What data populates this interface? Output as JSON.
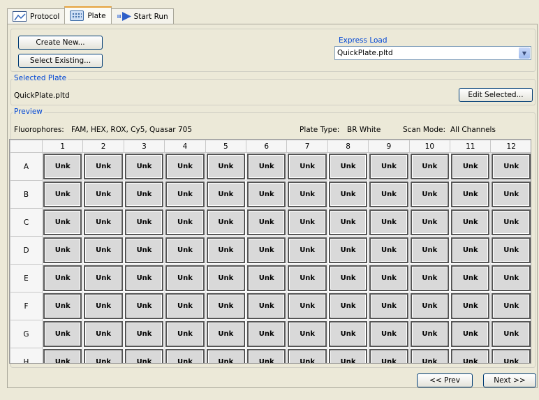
{
  "tabs": [
    {
      "label": "Protocol",
      "icon": "protocol-icon",
      "active": false
    },
    {
      "label": "Plate",
      "icon": "plate-icon",
      "active": true
    },
    {
      "label": "Start Run",
      "icon": "start-run-icon",
      "active": false
    }
  ],
  "buttons": {
    "create_new": "Create New...",
    "select_existing": "Select Existing...",
    "edit_selected": "Edit Selected...",
    "prev": "<< Prev",
    "next": "Next >>"
  },
  "express_load": {
    "label": "Express Load",
    "value": "QuickPlate.pltd"
  },
  "selected_plate": {
    "label": "Selected Plate",
    "value": "QuickPlate.pltd"
  },
  "preview": {
    "label": "Preview",
    "fluorophores_label": "Fluorophores:",
    "fluorophores_value": "FAM, HEX, ROX, Cy5, Quasar 705",
    "plate_type_label": "Plate Type:",
    "plate_type_value": "BR White",
    "scan_mode_label": "Scan Mode:",
    "scan_mode_value": "All Channels"
  },
  "plate": {
    "columns": [
      "1",
      "2",
      "3",
      "4",
      "5",
      "6",
      "7",
      "8",
      "9",
      "10",
      "11",
      "12"
    ],
    "rows": [
      "A",
      "B",
      "C",
      "D",
      "E",
      "F",
      "G",
      "H"
    ],
    "well_label": "Unk"
  },
  "colors": {
    "accent": "#0046d5",
    "well_fill": "#d9d9d9",
    "well_border": "#555555"
  }
}
